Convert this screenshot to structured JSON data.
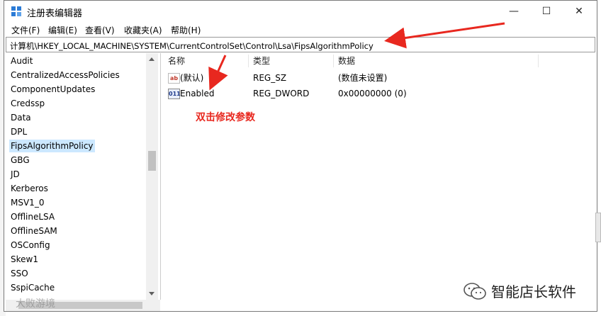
{
  "window": {
    "title": "注册表编辑器",
    "controls": {
      "minimize": "—",
      "maximize": "☐",
      "close": "✕"
    }
  },
  "menu": [
    "文件(F)",
    "编辑(E)",
    "查看(V)",
    "收藏夹(A)",
    "帮助(H)"
  ],
  "address": "计算机\\HKEY_LOCAL_MACHINE\\SYSTEM\\CurrentControlSet\\Control\\Lsa\\FipsAlgorithmPolicy",
  "tree": {
    "items": [
      "Audit",
      "CentralizedAccessPolicies",
      "ComponentUpdates",
      "Credssp",
      "Data",
      "DPL",
      "FipsAlgorithmPolicy",
      "GBG",
      "JD",
      "Kerberos",
      "MSV1_0",
      "OfflineLSA",
      "OfflineSAM",
      "OSConfig",
      "Skew1",
      "SSO",
      "SspiCache"
    ],
    "selected": "FipsAlgorithmPolicy"
  },
  "list": {
    "columns": [
      "名称",
      "类型",
      "数据"
    ],
    "rows": [
      {
        "name": "(默认)",
        "type": "REG_SZ",
        "data": "(数值未设置)",
        "icon": "string-value-icon"
      },
      {
        "name": "Enabled",
        "type": "REG_DWORD",
        "data": "0x00000000 (0)",
        "icon": "dword-value-icon"
      }
    ]
  },
  "annotation": "双击修改参数",
  "watermarks": {
    "left": "大败游境",
    "right": "智能店长软件"
  },
  "colors": {
    "accent": "#e8281f",
    "selection": "#cce8ff"
  }
}
